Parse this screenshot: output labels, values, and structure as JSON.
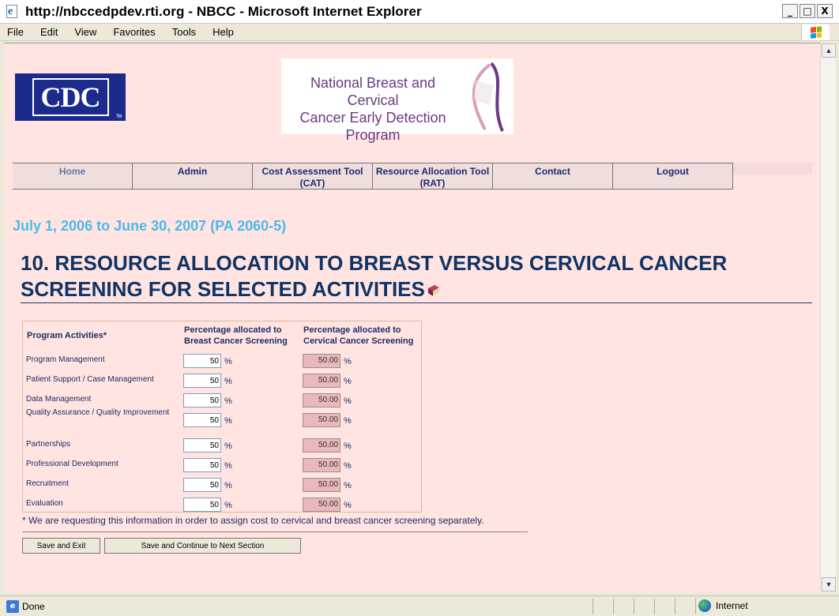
{
  "window": {
    "title": "http://nbccedpdev.rti.org - NBCC - Microsoft Internet Explorer",
    "controls": [
      "_",
      "□",
      "X"
    ]
  },
  "menu": [
    "File",
    "Edit",
    "View",
    "Favorites",
    "Tools",
    "Help"
  ],
  "logos": {
    "cdc": "CDC",
    "cdc_tm": "TM",
    "nbcc_line1": "National Breast and Cervical",
    "nbcc_line2": "Cancer Early Detection Program",
    "nbcc_color": "#6a3a82"
  },
  "nav": [
    "Home",
    "Admin",
    "Cost Assessment Tool (CAT)",
    "Resource Allocation Tool (RAT)",
    "Contact",
    "Logout"
  ],
  "period": "July 1, 2006 to June 30, 2007 (PA 2060-5)",
  "heading": {
    "line1": "10. RESOURCE ALLOCATION TO BREAST VERSUS CERVICAL CANCER",
    "line2": "SCREENING FOR SELECTED ACTIVITIES"
  },
  "table": {
    "col_activity": "Program Activities*",
    "col_breast": "Percentage allocated to Breast Cancer Screening",
    "col_cervical": "Percentage allocated to Cervical Cancer Screening",
    "unit": "%",
    "rows": [
      {
        "activity": "Program Management",
        "breast": "50",
        "cervical": "50.00"
      },
      {
        "activity": "Patient Support / Case Management",
        "breast": "50",
        "cervical": "50.00"
      },
      {
        "activity": "Data Management",
        "breast": "50",
        "cervical": "50.00"
      },
      {
        "activity": "Quality Assurance / Quality Improvement",
        "breast": "50",
        "cervical": "50.00"
      },
      {
        "activity": "Partnerships",
        "breast": "50",
        "cervical": "50.00"
      },
      {
        "activity": "Professional Development",
        "breast": "50",
        "cervical": "50.00"
      },
      {
        "activity": "Recruitment",
        "breast": "50",
        "cervical": "50.00"
      },
      {
        "activity": "Evaluation",
        "breast": "50",
        "cervical": "50.00"
      }
    ]
  },
  "footnote": "* We are requesting this information in order to assign cost to cervical and breast cancer screening separately.",
  "buttons": {
    "save_exit": "Save and Exit",
    "save_continue": "Save and Continue to Next Section"
  },
  "status": {
    "text": "Done",
    "zone": "Internet"
  },
  "colors": {
    "page_bg": "#ffe4e1",
    "heading": "#0f3366",
    "period": "#4cb9ec",
    "readonly_field": "#e9b8b8"
  }
}
